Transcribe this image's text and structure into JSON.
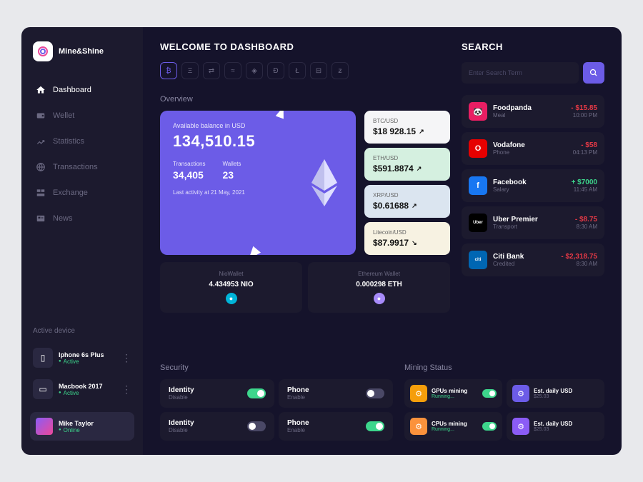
{
  "brand": "Mine&Shine",
  "nav": [
    {
      "label": "Dashboard",
      "icon": "home",
      "active": true
    },
    {
      "label": "Wellet",
      "icon": "wallet"
    },
    {
      "label": "Statistics",
      "icon": "stats"
    },
    {
      "label": "Transactions",
      "icon": "globe"
    },
    {
      "label": "Exchange",
      "icon": "exchange"
    },
    {
      "label": "News",
      "icon": "news"
    }
  ],
  "devices_title": "Active device",
  "devices": [
    {
      "name": "Iphone 6s Plus",
      "status": "Active"
    },
    {
      "name": "Macbook 2017",
      "status": "Active"
    }
  ],
  "profile": {
    "name": "Mike Taylor",
    "status": "Online"
  },
  "welcome": "WELCOME TO DASHBOARD",
  "search": {
    "heading": "SEARCH",
    "placeholder": "Enter Search Term"
  },
  "overview": {
    "label": "Overview",
    "balance_label": "Available balance in USD",
    "balance": "134,510.15",
    "transactions_label": "Transactions",
    "transactions": "34,405",
    "wallets_label": "Wallets",
    "wallets": "23",
    "activity": "Last activity at 21 May, 2021"
  },
  "pairs": [
    {
      "label": "BTC/USD",
      "value": "$18 928.15",
      "dir": "up"
    },
    {
      "label": "ETH/USD",
      "value": "$591.8874",
      "dir": "up"
    },
    {
      "label": "XRP/USD",
      "value": "$0.61688",
      "dir": "up"
    },
    {
      "label": "Litecoin/USD",
      "value": "$87.9917",
      "dir": "down"
    }
  ],
  "wallets_row": [
    {
      "name": "NioWallet",
      "balance": "4.434953 NIO",
      "color": "#00b4d8"
    },
    {
      "name": "Ethereum Wallet",
      "balance": "0.000298 ETH",
      "color": "#a78bfa"
    }
  ],
  "transactions": [
    {
      "name": "Foodpanda",
      "cat": "Meal",
      "amount": "- $15.85",
      "color": "#e63946",
      "time": "10:00 PM",
      "bg": "#e91e63",
      "icon": "🐼"
    },
    {
      "name": "Vodafone",
      "cat": "Phone",
      "amount": "- $58",
      "color": "#e63946",
      "time": "04:13 PM",
      "bg": "#e60000",
      "icon": "O"
    },
    {
      "name": "Facebook",
      "cat": "Salary",
      "amount": "+ $7000",
      "color": "#3dd68c",
      "time": "11:45 AM",
      "bg": "#1877f2",
      "icon": "f"
    },
    {
      "name": "Uber Premier",
      "cat": "Transport",
      "amount": "- $8.75",
      "color": "#e63946",
      "time": "8:30 AM",
      "bg": "#000",
      "icon": "Uber"
    },
    {
      "name": "Citi Bank",
      "cat": "Credited",
      "amount": "- $2,318.75",
      "color": "#e63946",
      "time": "8:30 AM",
      "bg": "#0066b3",
      "icon": "citi"
    }
  ],
  "security": {
    "label": "Security",
    "items": [
      {
        "name": "Identity",
        "state": "Disable",
        "on": true
      },
      {
        "name": "Phone",
        "state": "Enable",
        "on": false
      },
      {
        "name": "Identity",
        "state": "Disable",
        "on": false
      },
      {
        "name": "Phone",
        "state": "Enable",
        "on": true
      }
    ]
  },
  "mining": {
    "label": "Mining Status",
    "items": [
      {
        "name": "GPUs mining",
        "state": "Running...",
        "stateColor": "#3dd68c",
        "bg": "#f59e0b",
        "toggle": true
      },
      {
        "name": "Est. daily USD",
        "state": "$25.03",
        "stateColor": "#6b6982",
        "bg": "#6c5ce7"
      },
      {
        "name": "CPUs mining",
        "state": "Running...",
        "stateColor": "#3dd68c",
        "bg": "#fb923c",
        "toggle": true
      },
      {
        "name": "Est. daily USD",
        "state": "$25.03",
        "stateColor": "#6b6982",
        "bg": "#8b5cf6"
      }
    ]
  },
  "crypto_icons": [
    "₿",
    "Ξ",
    "⇄",
    "≈",
    "◈",
    "Ð",
    "Ł",
    "⊟",
    "ƶ"
  ]
}
